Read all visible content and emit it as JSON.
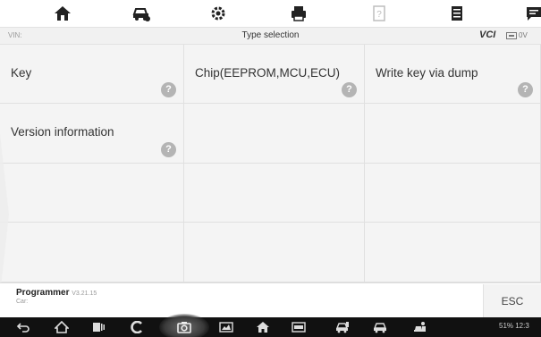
{
  "toolbar": {
    "icons": [
      "home-icon",
      "vehicle-icon",
      "settings-icon",
      "print-icon",
      "help-icon",
      "data-icon",
      "message-icon"
    ]
  },
  "header": {
    "vin_label": "VIN:",
    "title": "Type selection",
    "vci_label": "VCI",
    "battery_text": "0V"
  },
  "grid": {
    "items": [
      {
        "label": "Key",
        "help": "?"
      },
      {
        "label": "Chip(EEPROM,MCU,ECU)",
        "help": "?"
      },
      {
        "label": "Write key via dump",
        "help": "?"
      },
      {
        "label": "Version information",
        "help": "?"
      }
    ]
  },
  "footer": {
    "app_name": "Programmer",
    "app_version": "V3.21.15",
    "car_label": "Car:",
    "esc_label": "ESC"
  },
  "navbar": {
    "icons": [
      "back-icon",
      "home-icon",
      "recent-apps-icon",
      "chrome-icon",
      "camera-icon",
      "screenshot-icon",
      "home-icon",
      "vci-icon",
      "car-repair-icon",
      "car-icon",
      "car-person-icon"
    ],
    "status": "51% 12:3"
  },
  "colors": {
    "grid_bg": "#f4f4f4",
    "help_bg": "#b4b4b4",
    "navbar_bg": "#111111"
  }
}
